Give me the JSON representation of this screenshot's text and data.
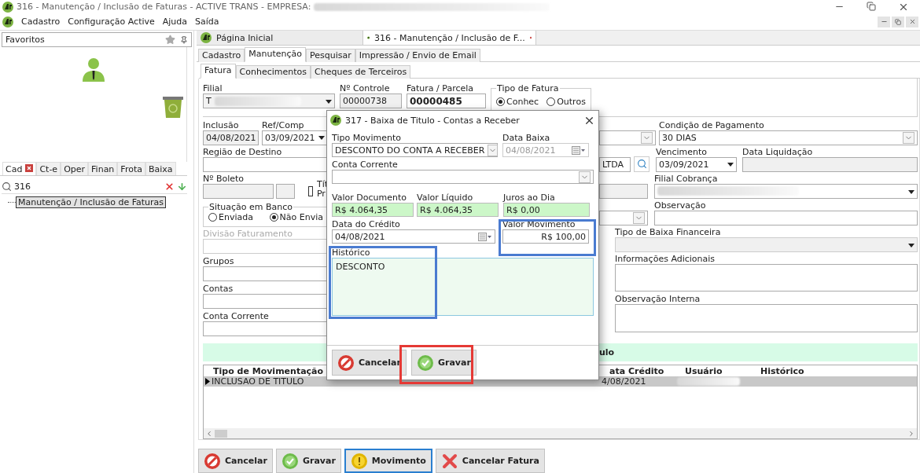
{
  "window": {
    "title": "316 - Manutenção / Inclusão de Faturas - ACTIVE TRANS - EMPRESA:"
  },
  "menu": [
    {
      "label": "Cadastro"
    },
    {
      "label": "Configuração Active"
    },
    {
      "label": "Ajuda"
    },
    {
      "label": "Saída"
    }
  ],
  "sidebar": {
    "favorites": "Favoritos",
    "tabs": [
      {
        "label": "Cad",
        "selected": true
      },
      {
        "label": "Ct-e",
        "selected": false
      },
      {
        "label": "Oper",
        "selected": false
      },
      {
        "label": "Finan",
        "selected": false
      },
      {
        "label": "Frota",
        "selected": false
      },
      {
        "label": "Baixa",
        "selected": false
      }
    ],
    "search": "316",
    "tree": [
      {
        "label": "Manutenção / Inclusão de Faturas",
        "selected": true
      }
    ]
  },
  "document_tabs": [
    {
      "label": "Página Inicial",
      "selected": false
    },
    {
      "label": "316 - Manutenção / Inclusão de F...",
      "selected": true
    }
  ],
  "tabs": [
    {
      "label": "Cadastro",
      "selected": false
    },
    {
      "label": "Manutenção",
      "selected": true
    },
    {
      "label": "Pesquisar",
      "selected": false
    },
    {
      "label": "Impressão / Envio de Email",
      "selected": false
    }
  ],
  "subtabs": [
    {
      "label": "Fatura",
      "selected": true
    },
    {
      "label": "Conhecimentos",
      "selected": false
    },
    {
      "label": "Cheques de Terceiros",
      "selected": false
    }
  ],
  "header": {
    "filial": {
      "label": "Filial",
      "value": "T"
    },
    "controle": {
      "label": "Nº Controle",
      "value": "00000738"
    },
    "fatura": {
      "label": "Fatura / Parcela",
      "value": "00000485"
    },
    "tipo_fatura": {
      "label": "Tipo de Fatura",
      "options": [
        {
          "label": "Conhec",
          "selected": true
        },
        {
          "label": "Outros",
          "selected": false
        }
      ]
    }
  },
  "left": {
    "inclusao": {
      "label": "Inclusão",
      "value": "04/08/2021"
    },
    "ref_comp": {
      "label": "Ref/Comp",
      "value": "03/09/2021"
    },
    "regiao": {
      "label": "Região de Destino"
    },
    "boleto": {
      "label": "Nº Boleto",
      "check_lines": [
        "Tít",
        "Pr"
      ],
      "checked": false
    },
    "situacao": {
      "label": "Situação em Banco",
      "options": [
        {
          "label": "Enviada",
          "selected": false
        },
        {
          "label": "Não Envia",
          "selected": true
        }
      ]
    },
    "fields": [
      {
        "label": "Divisão Faturamento",
        "disabled": true
      },
      {
        "label": "Grupos",
        "disabled": false
      },
      {
        "label": "Contas",
        "disabled": false
      },
      {
        "label": "Conta Corrente",
        "disabled": false
      }
    ]
  },
  "right": {
    "condicao": {
      "label": "Condição de Pagamento",
      "value": "30 DIAS"
    },
    "cliente_tail": "LTDA",
    "vencimento": {
      "label": "Vencimento",
      "value": "03/09/2021"
    },
    "liquidacao": {
      "label": "Data Liquidação"
    },
    "filial_cobranca": {
      "label": "Filial Cobrança"
    },
    "observacao": {
      "label": "Observação"
    },
    "tipo_baixa": {
      "label": "Tipo de Baixa Financeira"
    },
    "info": {
      "label": "Informações Adicionais"
    },
    "obs_interna": {
      "label": "Observação Interna"
    }
  },
  "movements": {
    "title_tail": "ulo",
    "columns": [
      "Tipo de Movimentação",
      "ata Crédito",
      "Usuário",
      "Histórico"
    ],
    "rows": [
      {
        "cells": [
          "INCLUSAO DE TITULO",
          "4/08/2021"
        ],
        "selected": true
      }
    ]
  },
  "buttons": [
    {
      "label": "Cancelar",
      "kind": "cancel",
      "focused": false
    },
    {
      "label": "Gravar",
      "kind": "save",
      "focused": false
    },
    {
      "label": "Movimento",
      "kind": "move",
      "focused": true
    },
    {
      "label": "Cancelar Fatura",
      "kind": "void",
      "focused": false
    }
  ],
  "dialog": {
    "title": "317 - Baixa de Titulo - Contas a Receber",
    "tipo_movimento": {
      "label": "Tipo Movimento",
      "value": "DESCONTO DO CONTA A RECEBER"
    },
    "data_baixa": {
      "label": "Data Baixa",
      "value": "04/08/2021",
      "disabled": true
    },
    "conta_corrente": {
      "label": "Conta Corrente"
    },
    "valores": [
      {
        "label": "Valor Documento",
        "value": "R$ 4.064,35"
      },
      {
        "label": "Valor Líquido",
        "value": "R$ 4.064,35"
      },
      {
        "label": "Juros ao Dia",
        "value": "R$ 0,00"
      }
    ],
    "data_credito": {
      "label": "Data do Crédito",
      "value": "04/08/2021"
    },
    "valor_movimento": {
      "label": "Valor Movimento",
      "value": "R$ 100,00"
    },
    "historico": {
      "label": "Histórico",
      "value": "DESCONTO"
    },
    "buttons": [
      {
        "label": "Cancelar",
        "kind": "cancel",
        "focused": false
      },
      {
        "label": "Gravar",
        "kind": "save",
        "focused": false
      }
    ]
  }
}
